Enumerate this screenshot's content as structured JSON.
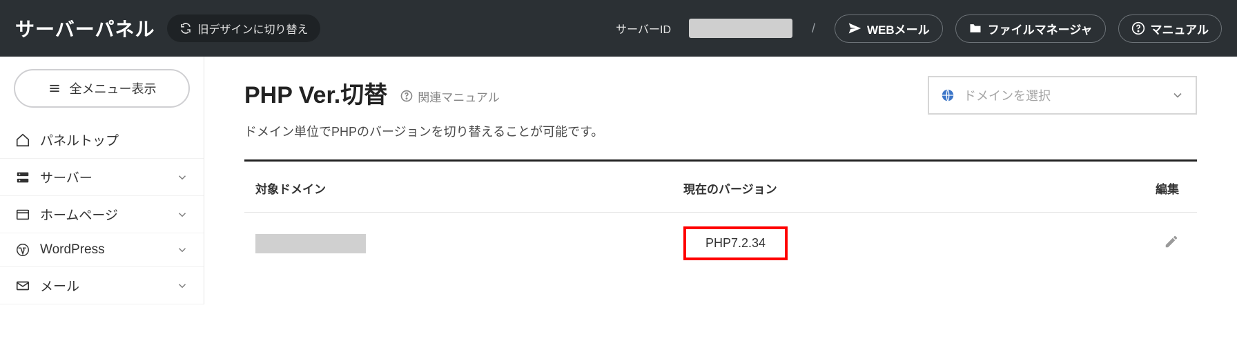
{
  "header": {
    "app_title": "サーバーパネル",
    "old_design": "旧デザインに切り替え",
    "server_id_label": "サーバーID",
    "server_id_value": "",
    "webmail": "WEBメール",
    "filemanager": "ファイルマネージャ",
    "manual": "マニュアル"
  },
  "sidebar": {
    "all_menu": "全メニュー表示",
    "items": [
      {
        "label": "パネルトップ",
        "icon": "home",
        "expandable": false
      },
      {
        "label": "サーバー",
        "icon": "server",
        "expandable": true
      },
      {
        "label": "ホームページ",
        "icon": "window",
        "expandable": true
      },
      {
        "label": "WordPress",
        "icon": "wordpress",
        "expandable": true
      },
      {
        "label": "メール",
        "icon": "mail",
        "expandable": true
      }
    ]
  },
  "main": {
    "title": "PHP Ver.切替",
    "related": "関連マニュアル",
    "domain_select_placeholder": "ドメインを選択",
    "description": "ドメイン単位でPHPのバージョンを切り替えることが可能です。",
    "columns": {
      "domain": "対象ドメイン",
      "version": "現在のバージョン",
      "edit": "編集"
    },
    "rows": [
      {
        "domain": "",
        "version": "PHP7.2.34"
      }
    ]
  }
}
